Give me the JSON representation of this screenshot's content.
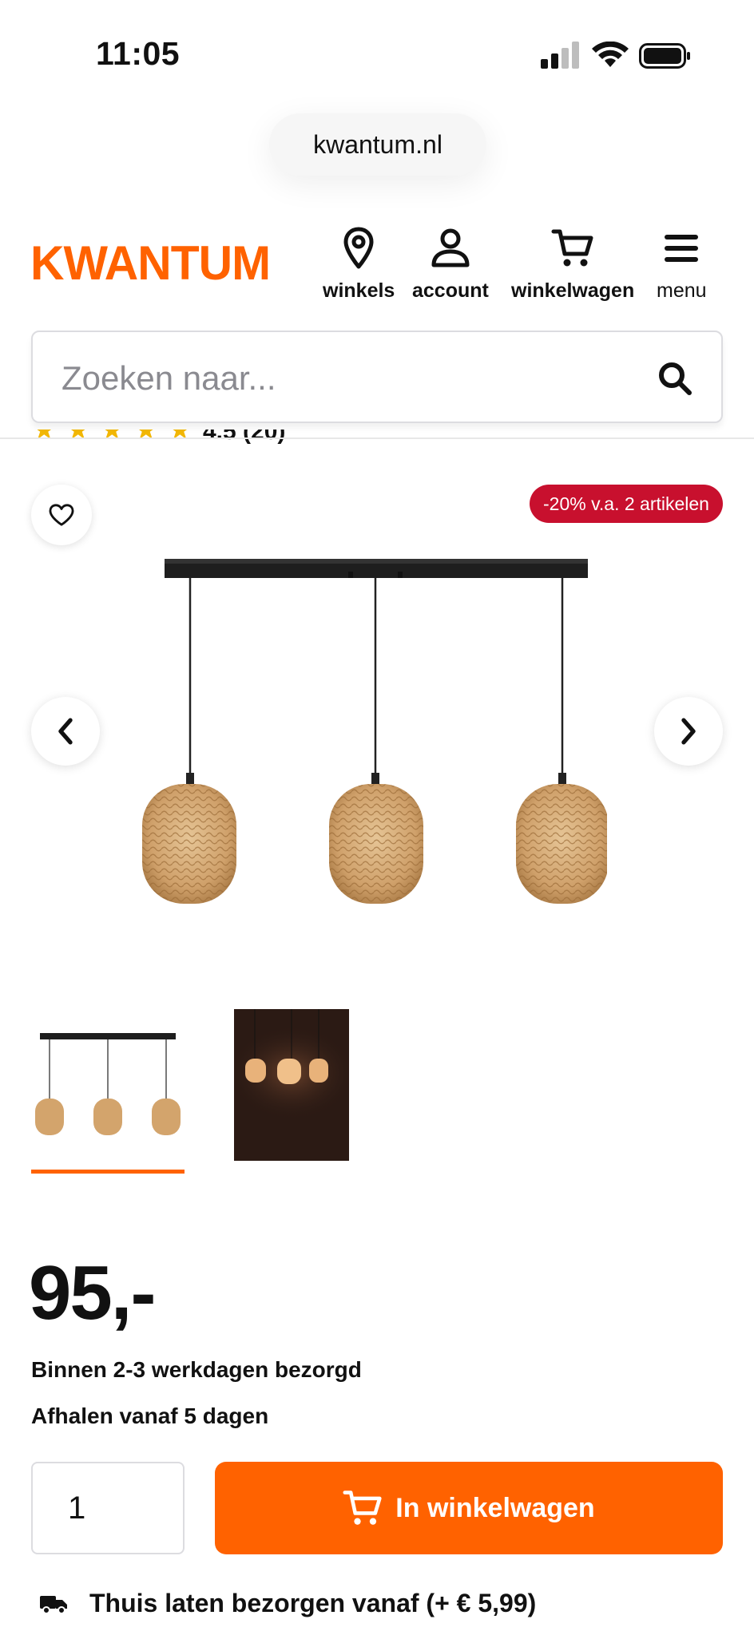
{
  "status": {
    "time": "11:05"
  },
  "browser": {
    "url": "kwantum.nl"
  },
  "header": {
    "logo": "KWANTUM",
    "nav": [
      {
        "label": "winkels",
        "icon": "location-pin-icon"
      },
      {
        "label": "account",
        "icon": "user-icon"
      },
      {
        "label": "winkelwagen",
        "icon": "cart-icon"
      },
      {
        "label": "menu",
        "icon": "hamburger-menu-icon"
      }
    ]
  },
  "search": {
    "placeholder": "Zoeken naar..."
  },
  "rating": {
    "text": "4.5 (20)"
  },
  "gallery": {
    "promo": "-20% v.a. 2 artikelen"
  },
  "product": {
    "price": "95,-",
    "delivery": "Binnen 2-3 werkdagen bezorgd",
    "pickup": "Afhalen vanaf 5 dagen",
    "quantity": "1",
    "add_to_cart": "In winkelwagen",
    "shipping": "Thuis laten bezorgen vanaf (+ € 5,99)"
  },
  "colors": {
    "brand": "#ff6200",
    "promo": "#c8102e"
  }
}
